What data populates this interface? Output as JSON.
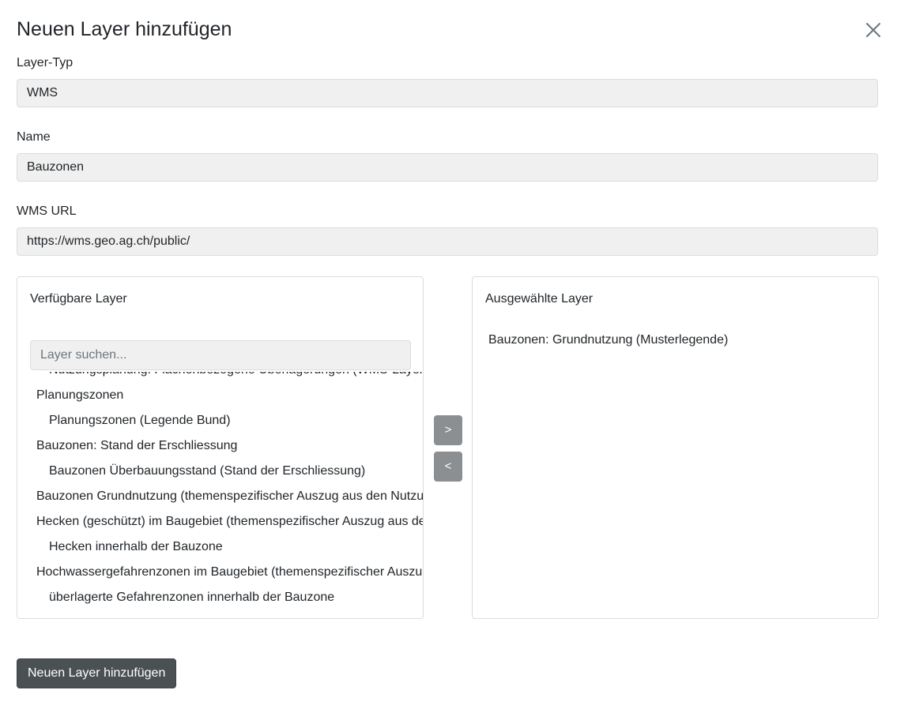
{
  "dialog": {
    "title": "Neuen Layer hinzufügen",
    "close_icon": "close-icon"
  },
  "form": {
    "layer_type_label": "Layer-Typ",
    "layer_type_value": "WMS",
    "name_label": "Name",
    "name_value": "Bauzonen",
    "url_label": "WMS URL",
    "url_value": "https://wms.geo.ag.ch/public/"
  },
  "available": {
    "heading": "Verfügbare Layer",
    "search_placeholder": "Layer suchen...",
    "items": [
      {
        "label": "Nutzungsplanung: Flächenbezogene Überlagerungen (WMS-Layer)",
        "level": 1
      },
      {
        "label": "Planungszonen",
        "level": 0
      },
      {
        "label": "Planungszonen (Legende Bund)",
        "level": 1
      },
      {
        "label": "Bauzonen: Stand der Erschliessung",
        "level": 0
      },
      {
        "label": "Bauzonen Überbauungsstand (Stand der Erschliessung)",
        "level": 1
      },
      {
        "label": "Bauzonen Grundnutzung (themenspezifischer Auszug aus den Nutzungsplänen)",
        "level": 0
      },
      {
        "label": "Hecken (geschützt) im Baugebiet (themenspezifischer Auszug aus den Nutzungsplänen)",
        "level": 0
      },
      {
        "label": "Hecken innerhalb der Bauzone",
        "level": 1
      },
      {
        "label": "Hochwassergefahrenzonen im Baugebiet (themenspezifischer Auszug aus den Nutzungsplänen)",
        "level": 0
      },
      {
        "label": "überlagerte Gefahrenzonen innerhalb der Bauzone",
        "level": 1
      }
    ]
  },
  "selected": {
    "heading": "Ausgewählte Layer",
    "items": [
      {
        "label": "Bauzonen: Grundnutzung (Musterlegende)"
      }
    ]
  },
  "actions": {
    "move_right_label": ">",
    "move_left_label": "<",
    "submit_label": "Neuen Layer hinzufügen"
  }
}
